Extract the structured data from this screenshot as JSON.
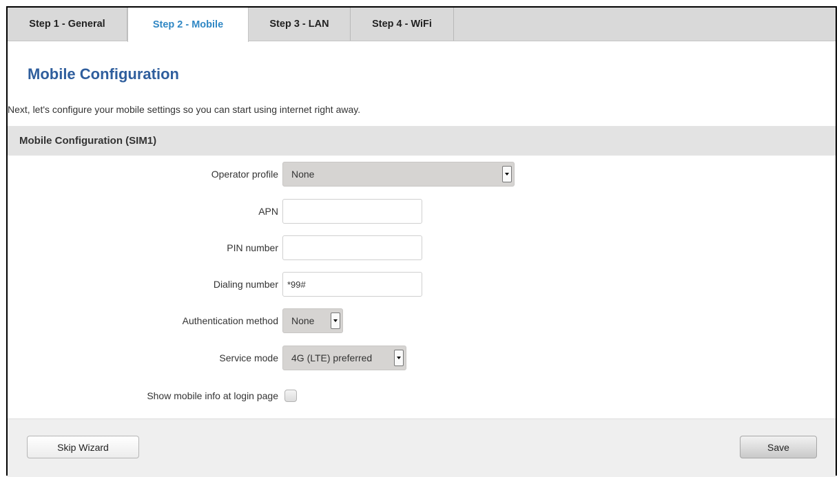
{
  "tabs": [
    {
      "label": "Step 1 - General",
      "active": false
    },
    {
      "label": "Step 2 - Mobile",
      "active": true
    },
    {
      "label": "Step 3 - LAN",
      "active": false
    },
    {
      "label": "Step 4 - WiFi",
      "active": false
    }
  ],
  "page": {
    "title": "Mobile Configuration",
    "intro": "Next, let's configure your mobile settings so you can start using internet right away."
  },
  "section": {
    "title": "Mobile Configuration (SIM1)"
  },
  "form": {
    "operator_profile": {
      "label": "Operator profile",
      "value": "None"
    },
    "apn": {
      "label": "APN",
      "value": ""
    },
    "pin": {
      "label": "PIN number",
      "value": ""
    },
    "dialing": {
      "label": "Dialing number",
      "value": "*99#"
    },
    "auth": {
      "label": "Authentication method",
      "value": "None"
    },
    "service_mode": {
      "label": "Service mode",
      "value": "4G (LTE) preferred"
    },
    "show_mobile_info": {
      "label": "Show mobile info at login page",
      "checked": false
    }
  },
  "footer": {
    "skip_label": "Skip Wizard",
    "save_label": "Save"
  },
  "colors": {
    "accent": "#2f87c4",
    "title": "#2f5e9d"
  }
}
